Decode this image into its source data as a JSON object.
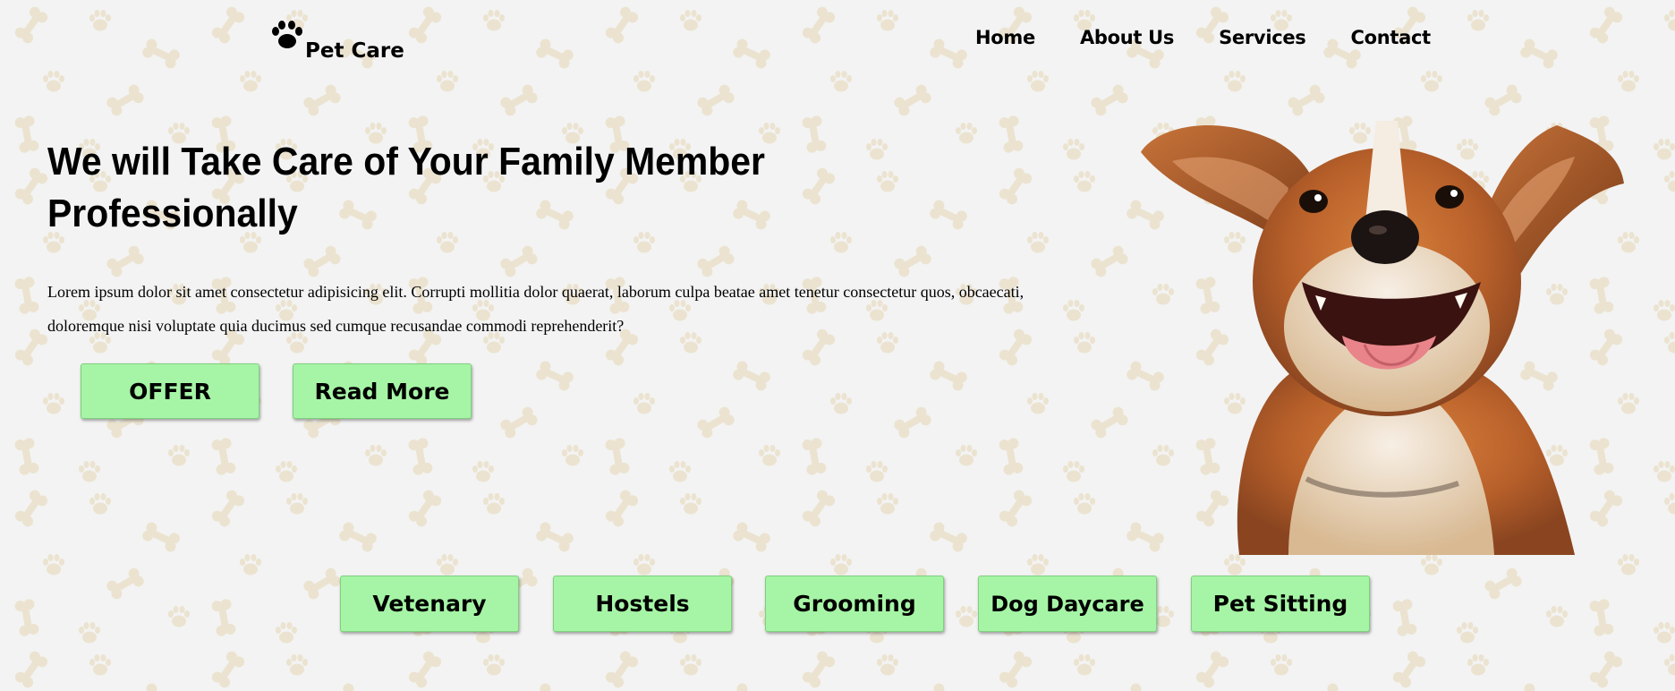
{
  "brand": {
    "name": "Pet Care",
    "logo_icon": "paw-icon"
  },
  "nav": {
    "items": [
      {
        "label": "Home"
      },
      {
        "label": "About Us"
      },
      {
        "label": "Services"
      },
      {
        "label": "Contact"
      }
    ]
  },
  "hero": {
    "title": "We will Take Care of Your Family Member Professionally",
    "text": "Lorem ipsum dolor sit amet consectetur adipisicing elit. Corrupti mollitia dolor quaerat, laborum culpa beatae amet tenetur consectetur quos, obcaecati, doloremque nisi voluptate quia ducimus sed cumque recusandae commodi reprehenderit?",
    "buttons": {
      "offer": "OFFER",
      "read_more": "Read More"
    },
    "image": "happy-dog-image"
  },
  "services": [
    {
      "label": "Vetenary"
    },
    {
      "label": "Hostels"
    },
    {
      "label": "Grooming"
    },
    {
      "label": "Dog Daycare"
    },
    {
      "label": "Pet Sitting"
    }
  ],
  "colors": {
    "background": "#f3f3f3",
    "pattern": "#ebe3d0",
    "button": "#a6f5a6",
    "text": "#000000"
  }
}
